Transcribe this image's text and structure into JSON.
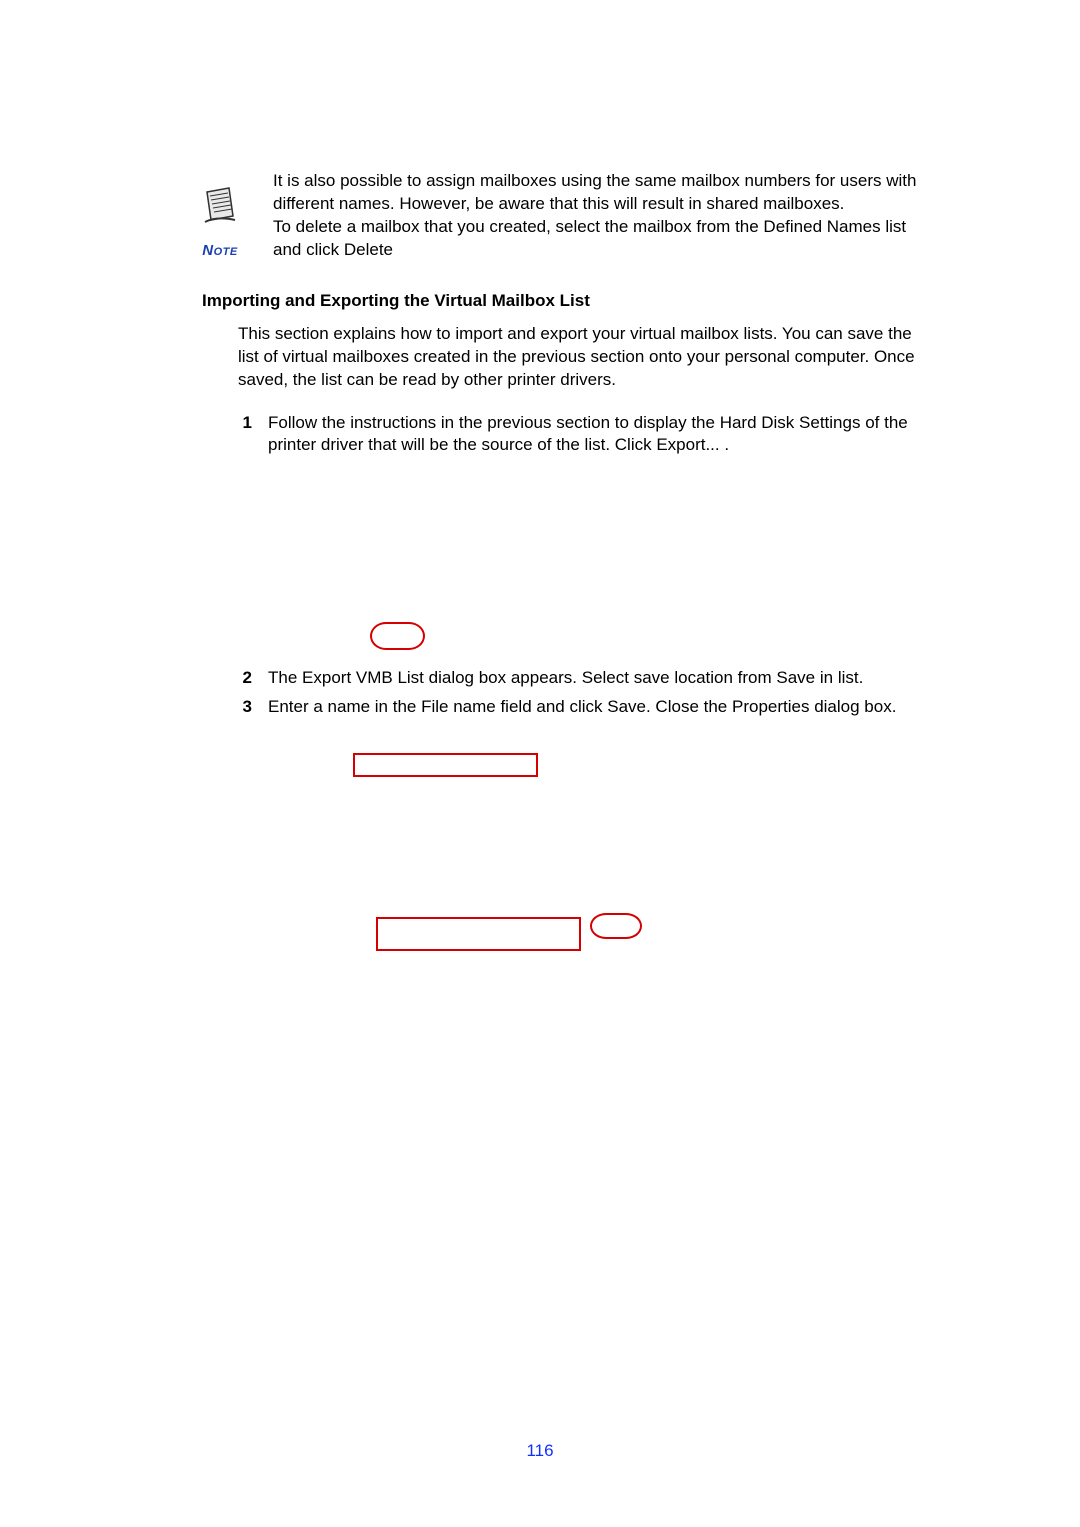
{
  "note": {
    "label": "Note",
    "paragraph1_a": "It is also possible to assign mailboxes using the same mailbox numbers for users with different names. However, be ",
    "paragraph1_b": "aware ",
    "paragraph1_c": "that this will result in shared mailboxes.",
    "paragraph2_a": "To delete a mailbox that you created, select the mailbox from the Defined Names list and click ",
    "paragraph2_b": "Delete"
  },
  "section_heading": "Importing and Exporting the Virtual Mailbox List",
  "intro_a": "This section explains how to import and export your virtual mailbox lists. You can save the list of virtual mailboxes created in ",
  "intro_b": "the previous section onto your ",
  "intro_c": "personal computer. Once saved, the list can be read by other printer drivers.",
  "steps": {
    "s1_num": "1",
    "s1_a": "Follow the instructions in the previous section to display ",
    "s1_b": "the ",
    "s1_c": "Hard Disk Settings",
    "s1_d": " of the printer driver that will be ",
    "s1_e": "the source of the list. Click ",
    "s1_f": "Export...",
    "s1_g": " .",
    "s2_num": "2",
    "s2_a": "The ",
    "s2_b": "Export VMB List",
    "s2_c": " dialog box appears. Select save location from ",
    "s2_d": "Save in",
    "s2_e": " list.",
    "s3_num": "3",
    "s3_a": "Enter a name in the ",
    "s3_b": "File name",
    "s3_c": " field and click ",
    "s3_d": "Save",
    "s3_e": ". Close the ",
    "s3_f": "Properties",
    "s3_g": " dialog box."
  },
  "page_number": "116"
}
